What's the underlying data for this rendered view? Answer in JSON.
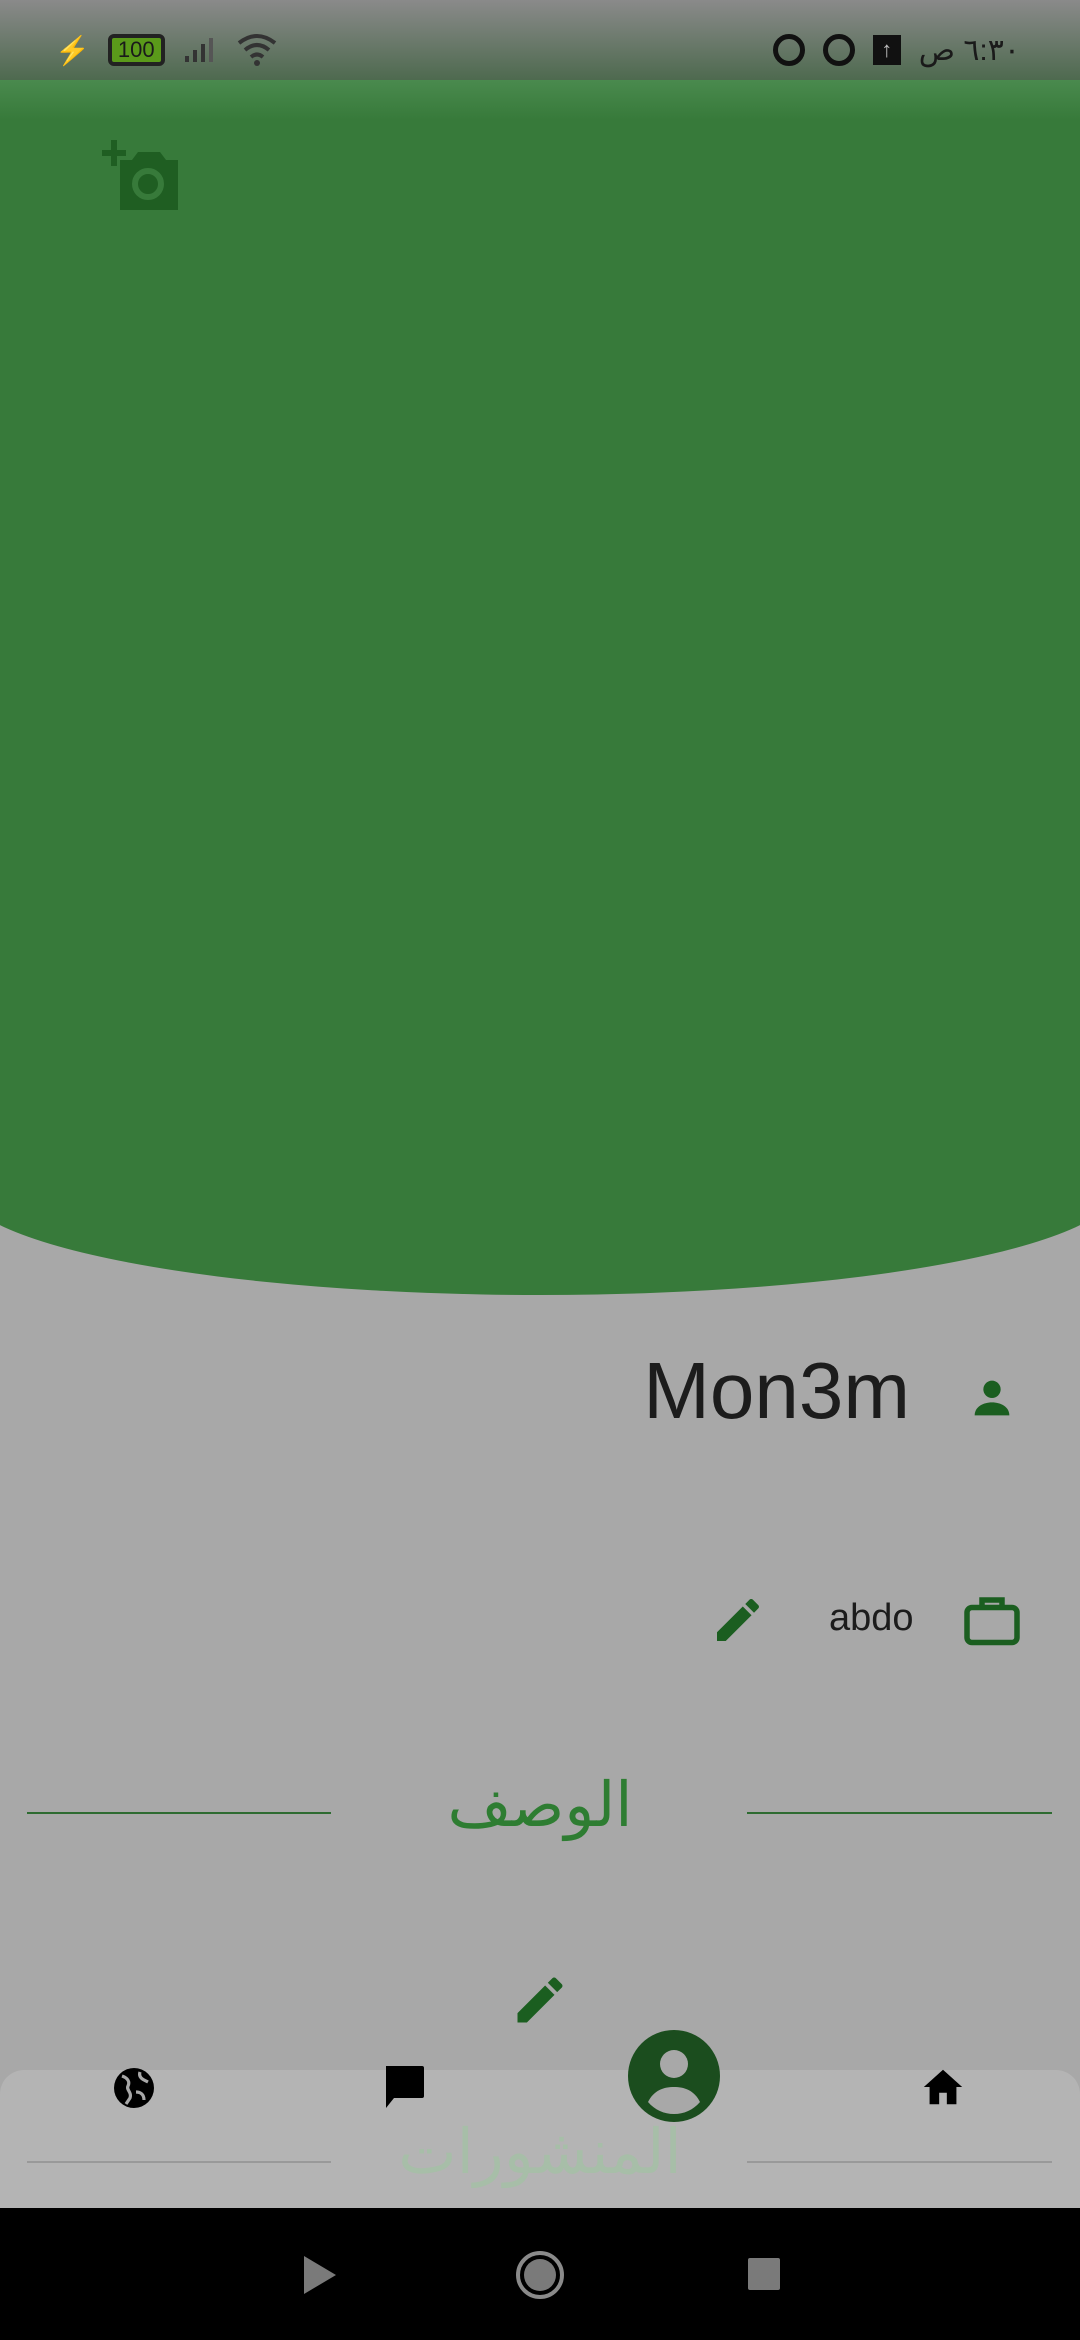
{
  "status_bar": {
    "time": "٦:٣٠ ص",
    "battery": "100"
  },
  "profile": {
    "name": "Mon3m",
    "job": "abdo"
  },
  "sections": {
    "description": "الوصف",
    "posts": "المنشورات"
  },
  "bottom_nav": {
    "items": [
      "globe",
      "chat",
      "profile",
      "home"
    ],
    "active": "profile"
  },
  "colors": {
    "primary": "#377a3a",
    "dark_green": "#1b5e20"
  }
}
